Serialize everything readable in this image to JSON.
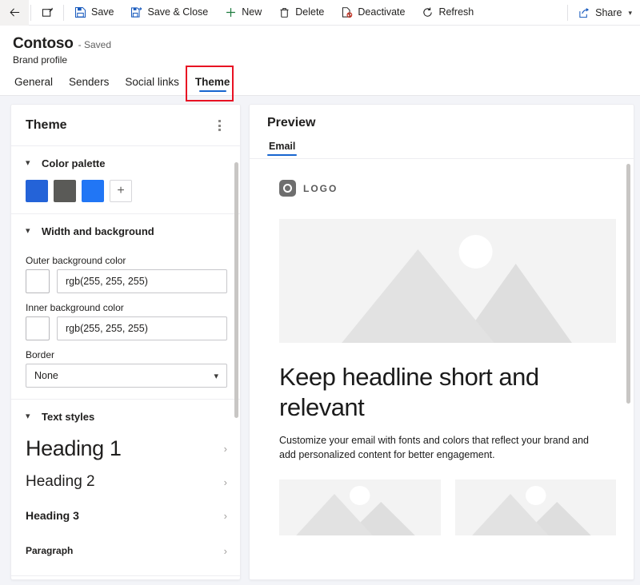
{
  "commandbar": {
    "back_label": "Back",
    "popout_label": "Open in new window",
    "buttons": [
      {
        "label": "Save",
        "icon": "save-icon"
      },
      {
        "label": "Save & Close",
        "icon": "save-and-close-icon"
      },
      {
        "label": "New",
        "icon": "plus-icon"
      },
      {
        "label": "Delete",
        "icon": "trash-icon"
      },
      {
        "label": "Deactivate",
        "icon": "deactivate-icon"
      },
      {
        "label": "Refresh",
        "icon": "refresh-icon"
      }
    ],
    "share_label": "Share"
  },
  "header": {
    "title": "Contoso",
    "saved_status": "- Saved",
    "subtitle": "Brand profile",
    "tabs": [
      {
        "label": "General",
        "active": false
      },
      {
        "label": "Senders",
        "active": false
      },
      {
        "label": "Social links",
        "active": false
      },
      {
        "label": "Theme",
        "active": true
      }
    ]
  },
  "theme_panel": {
    "title": "Theme",
    "more_options": "more-options",
    "sections": {
      "color_palette": {
        "title": "Color palette",
        "swatches": [
          "#2463d8",
          "#5a5a57",
          "#2176f5"
        ],
        "add_label": "+"
      },
      "width_background": {
        "title": "Width and background",
        "fields": [
          {
            "label": "Outer background color",
            "value": "rgb(255, 255, 255)",
            "chip": "#ffffff"
          },
          {
            "label": "Inner background color",
            "value": "rgb(255, 255, 255)",
            "chip": "#ffffff"
          }
        ],
        "border": {
          "label": "Border",
          "value": "None"
        }
      },
      "text_styles": {
        "title": "Text styles",
        "items": [
          {
            "label": "Heading 1"
          },
          {
            "label": "Heading 2"
          },
          {
            "label": "Heading 3"
          },
          {
            "label": "Paragraph"
          }
        ]
      }
    }
  },
  "preview": {
    "title": "Preview",
    "tabs": [
      {
        "label": "Email",
        "active": true
      }
    ],
    "email": {
      "logo_text": "LOGO",
      "headline": "Keep headline short and relevant",
      "body": "Customize your email with fonts and colors that reflect your brand and add personalized content for better engagement."
    }
  },
  "colors": {
    "accent": "#1765cf",
    "highlight_box": "#e81123",
    "page_background": "#f3f4f8",
    "placeholder_gray": "#f3f3f3"
  }
}
